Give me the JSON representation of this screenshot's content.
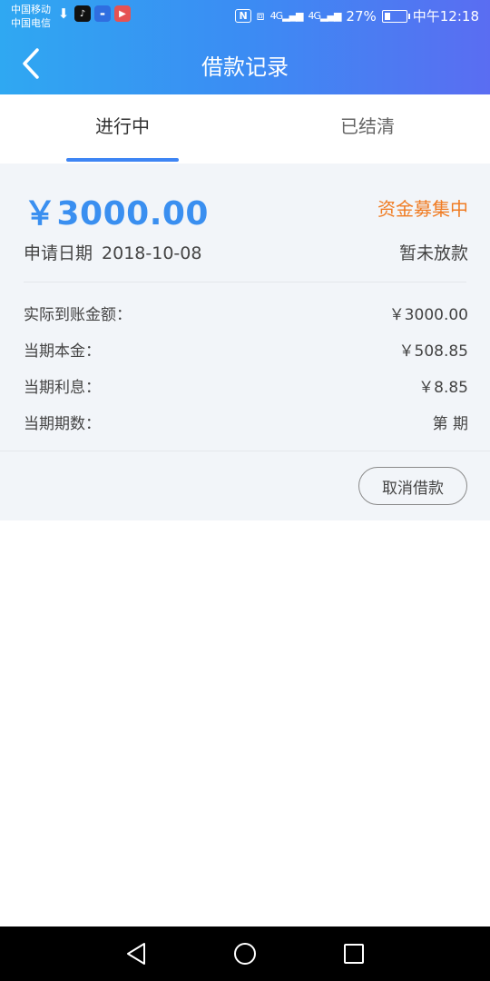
{
  "status_bar": {
    "carrier1": "中国移动",
    "carrier2": "中国电信",
    "nfc": "N",
    "net1": "4G",
    "net2": "4G",
    "battery_percent": "27%",
    "battery_level": 0.27,
    "time": "中午12:18"
  },
  "nav": {
    "title": "借款记录"
  },
  "tabs": [
    {
      "label": "进行中",
      "active": true
    },
    {
      "label": "已结清",
      "active": false
    }
  ],
  "loan": {
    "amount": "￥3000.00",
    "status_tag": "资金募集中",
    "apply_date_label": "申请日期",
    "apply_date": "2018-10-08",
    "disbursement_status": "暂未放款",
    "details": [
      {
        "label": "实际到账金额：",
        "value": "￥3000.00"
      },
      {
        "label": "当期本金：",
        "value": "￥508.85"
      },
      {
        "label": "当期利息：",
        "value": "￥8.85"
      },
      {
        "label": "当期期数：",
        "value": "第 期"
      }
    ],
    "cancel_label": "取消借款"
  },
  "colors": {
    "accent": "#3a8ff0",
    "status_orange": "#f07c23",
    "header_gradient_start": "#2fa8f2",
    "header_gradient_end": "#5a6df2"
  }
}
